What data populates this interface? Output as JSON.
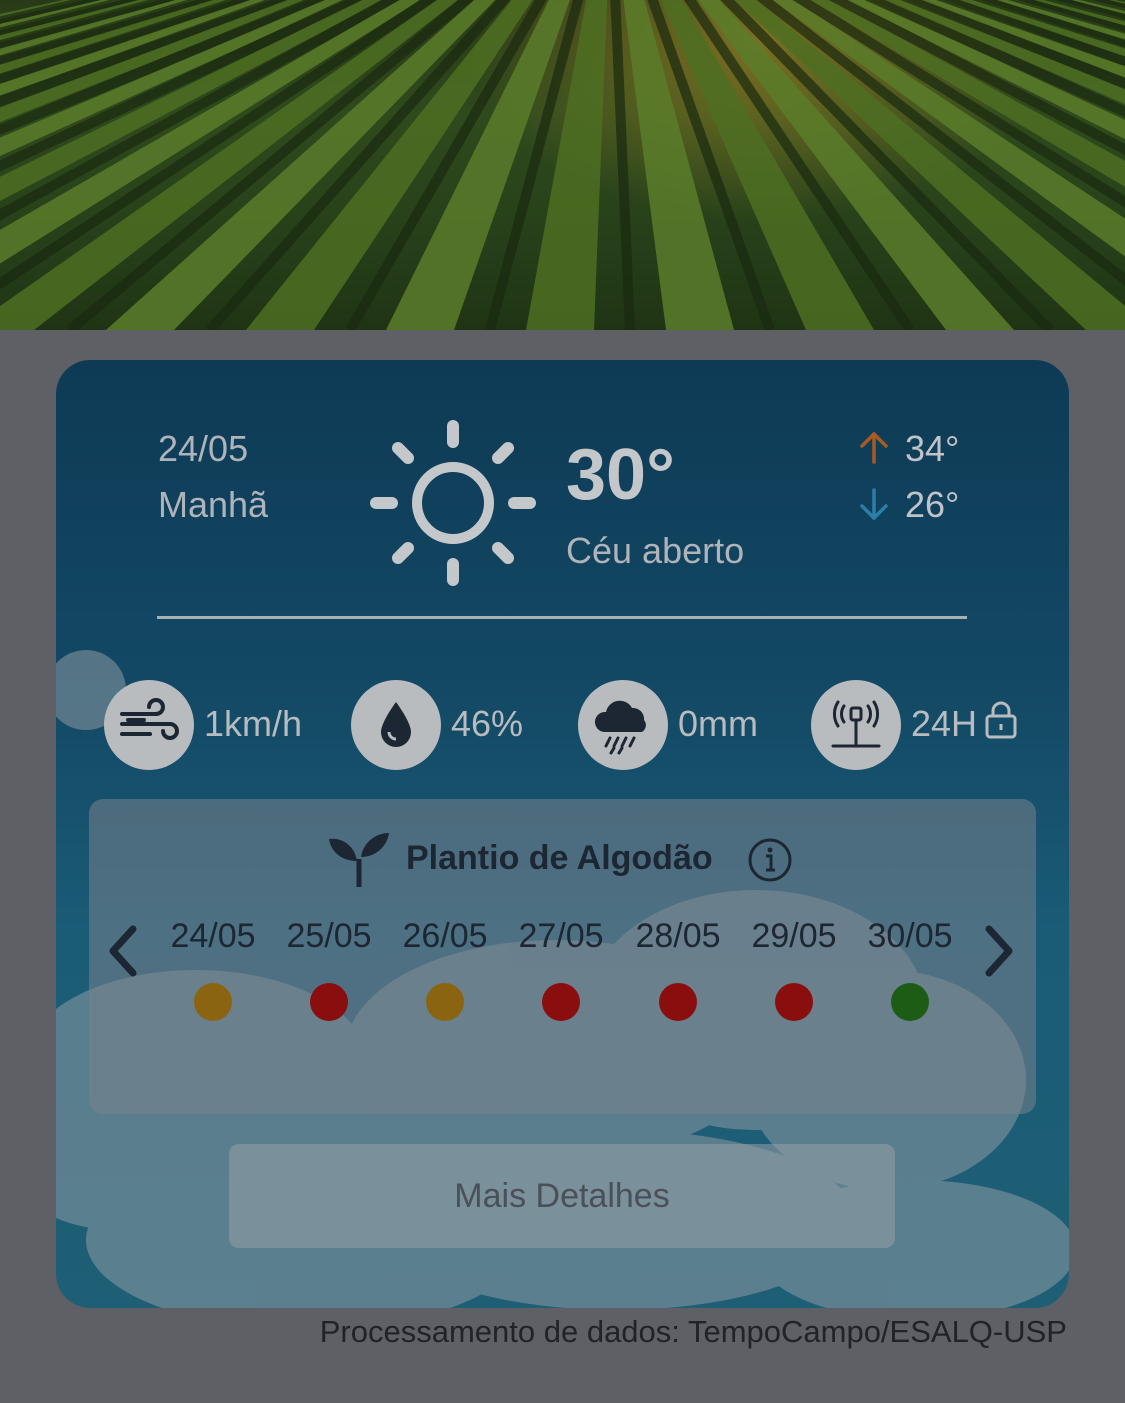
{
  "hero": {
    "icon": "crop-field-photo"
  },
  "weather": {
    "date": "24/05",
    "period": "Manhã",
    "condition_icon": "sun-icon",
    "temperature": "30°",
    "condition": "Céu aberto",
    "max": "34°",
    "min": "26°",
    "colors": {
      "max_arrow": "#a85a22",
      "min_arrow": "#2a7ea8"
    }
  },
  "stats": {
    "wind": {
      "icon": "wind-icon",
      "value": "1km/h"
    },
    "humidity": {
      "icon": "drop-icon",
      "value": "46%"
    },
    "rain": {
      "icon": "rain-cloud-icon",
      "value": "0mm"
    },
    "station": {
      "icon": "antenna-icon",
      "value": "24H",
      "lock_icon": "lock-icon"
    }
  },
  "planting": {
    "title": "Plantio de Algodão",
    "days": [
      {
        "date": "24/05",
        "color": "#8a6410"
      },
      {
        "date": "25/05",
        "color": "#8a0e0e"
      },
      {
        "date": "26/05",
        "color": "#8a6410"
      },
      {
        "date": "27/05",
        "color": "#8a0e0e"
      },
      {
        "date": "28/05",
        "color": "#8a0e0e"
      },
      {
        "date": "29/05",
        "color": "#8a0e0e"
      },
      {
        "date": "30/05",
        "color": "#1c5c14"
      }
    ]
  },
  "actions": {
    "details_label": "Mais Detalhes"
  },
  "footer": {
    "text": "Processamento de dados: TempoCampo/ESALQ-USP"
  }
}
